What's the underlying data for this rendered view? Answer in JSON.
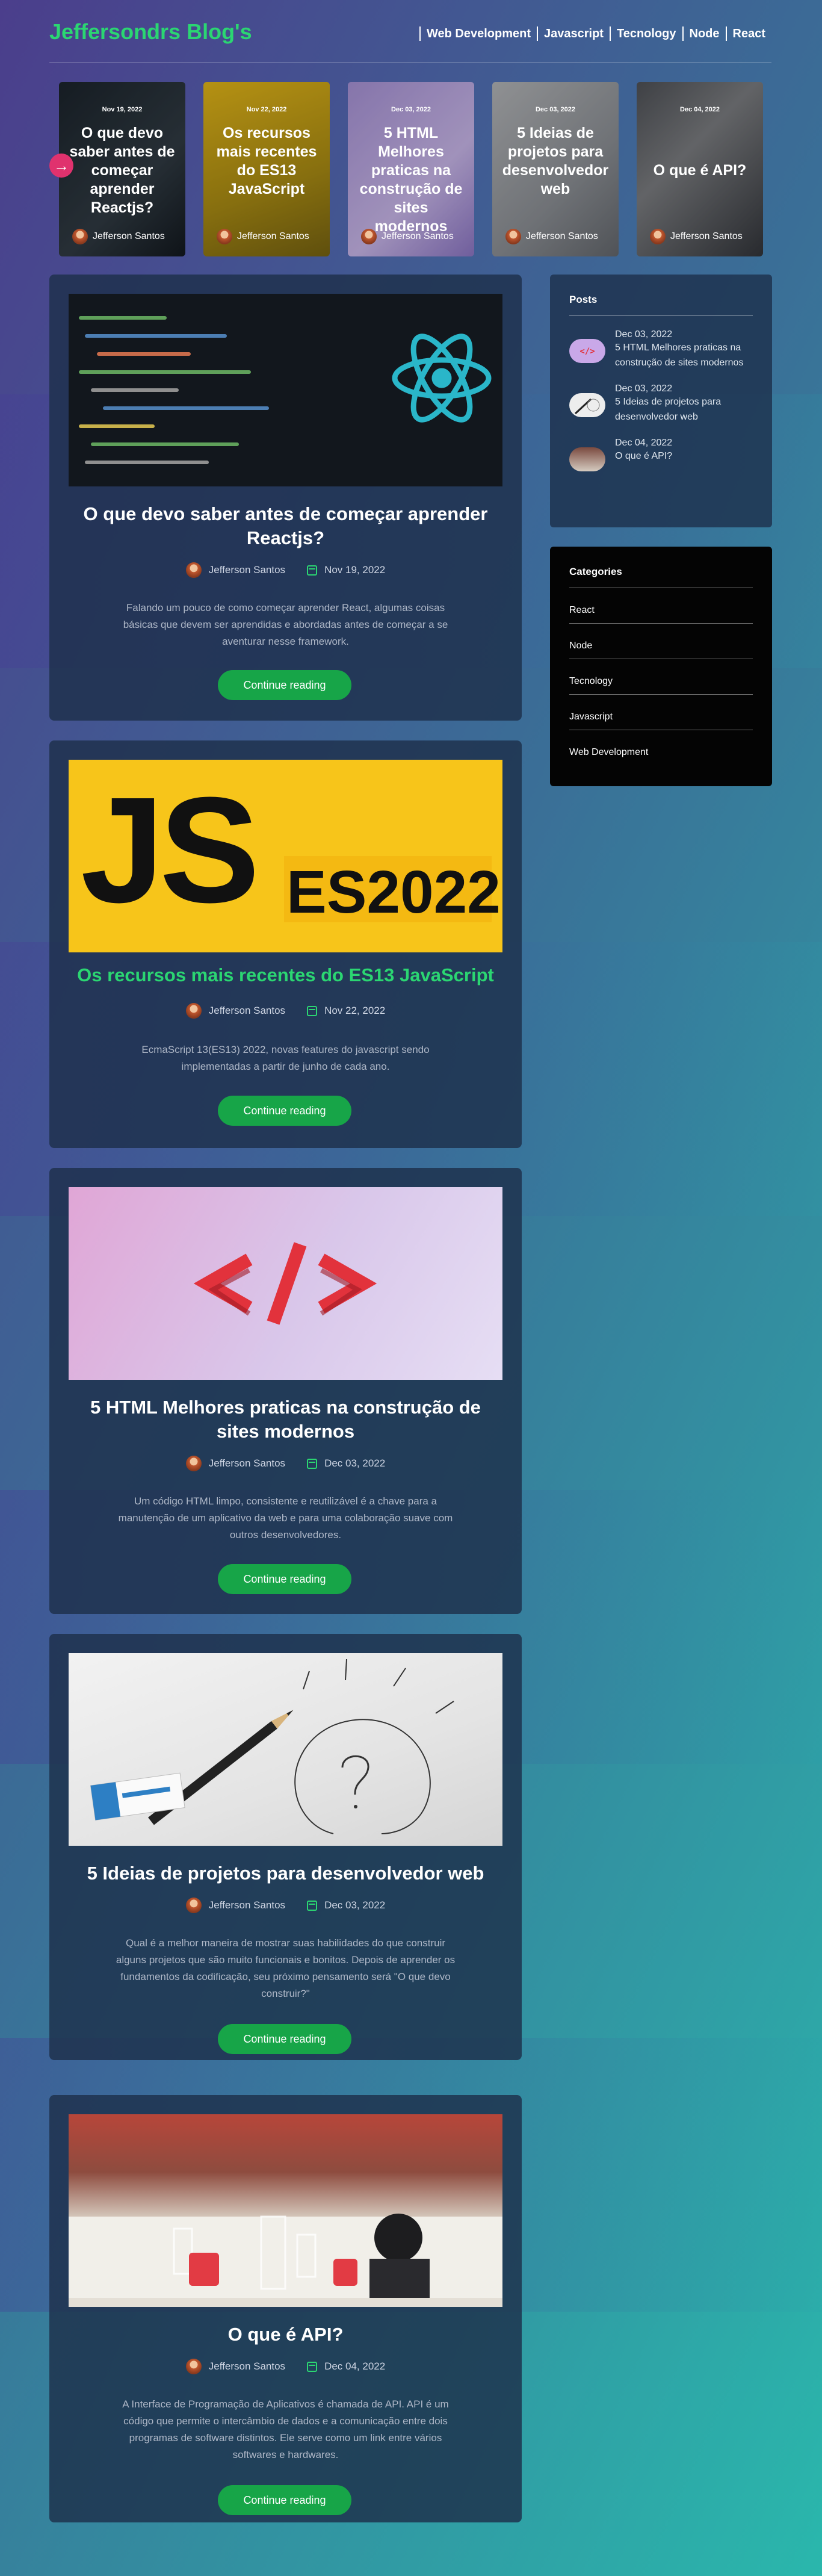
{
  "brand": {
    "title": "Jeffersondrs Blog's",
    "accent": "#2bd672"
  },
  "nav": [
    "Web Development",
    "Javascript",
    "Tecnology",
    "Node",
    "React"
  ],
  "slider": {
    "prev_icon": "arrow-right",
    "slides": [
      {
        "date": "Nov 19, 2022",
        "title": "O que devo saber antes de começar aprender Reactjs?",
        "author": "Jefferson Santos"
      },
      {
        "date": "Nov 22, 2022",
        "title": "Os recursos mais recentes do ES13 JavaScript",
        "author": "Jefferson Santos"
      },
      {
        "date": "Dec 03, 2022",
        "title": "5 HTML Melhores praticas na construção de sites modernos",
        "author": "Jefferson Santos"
      },
      {
        "date": "Dec 03, 2022",
        "title": "5 Ideias de projetos para desenvolvedor web",
        "author": "Jefferson Santos"
      },
      {
        "date": "Dec 04, 2022",
        "title": "O que é API?",
        "author": "Jefferson Santos"
      }
    ]
  },
  "posts": [
    {
      "title": "O que devo saber antes de começar aprender Reactjs?",
      "author": "Jefferson Santos",
      "date": "Nov 19, 2022",
      "excerpt": "Falando um pouco de como começar aprender React, algumas coisas básicas que devem ser aprendidas e abordadas antes de começar a se aventurar nesse framework.",
      "cta": "Continue reading",
      "title_color": "#ffffff"
    },
    {
      "title": "Os recursos mais recentes do ES13 JavaScript",
      "author": "Jefferson Santos",
      "date": "Nov 22, 2022",
      "excerpt": "EcmaScript 13(ES13) 2022, novas features do javascript sendo implementadas a partir de junho de cada ano.",
      "cta": "Continue reading",
      "title_color": "#2bd672",
      "img_text": {
        "js": "JS",
        "es": "ES2022"
      }
    },
    {
      "title": "5 HTML Melhores praticas na construção de sites modernos",
      "author": "Jefferson Santos",
      "date": "Dec 03, 2022",
      "excerpt": "Um código HTML limpo, consistente e reutilizável é a chave para a manutenção de um aplicativo da web e para uma colaboração suave com outros desenvolvedores.",
      "cta": "Continue reading",
      "title_color": "#ffffff"
    },
    {
      "title": "5 Ideias de projetos para desenvolvedor web",
      "author": "Jefferson Santos",
      "date": "Dec 03, 2022",
      "excerpt": "Qual é a melhor maneira de mostrar suas habilidades do que construir alguns projetos que são muito funcionais e bonitos. Depois de aprender os fundamentos da codificação, seu próximo pensamento será \"O que devo construir?\"",
      "cta": "Continue reading",
      "title_color": "#ffffff"
    },
    {
      "title": "O que é API?",
      "author": "Jefferson Santos",
      "date": "Dec 04, 2022",
      "excerpt": "A Interface de Programação de Aplicativos é chamada de API. API é um código que permite o intercâmbio de dados e a comunicação entre dois programas de software distintos. Ele serve como um link entre vários softwares e hardwares.",
      "cta": "Continue reading",
      "title_color": "#ffffff"
    }
  ],
  "sidebar": {
    "posts_heading": "Posts",
    "recent": [
      {
        "date": "Dec 03, 2022",
        "title": "5 HTML Melhores praticas na construção de sites modernos"
      },
      {
        "date": "Dec 03, 2022",
        "title": "5 Ideias de projetos para desenvolvedor web"
      },
      {
        "date": "Dec 04, 2022",
        "title": "O que é API?"
      }
    ],
    "categories_heading": "Categories",
    "categories": [
      "React",
      "Node",
      "Tecnology",
      "Javascript",
      "Web Development"
    ]
  }
}
